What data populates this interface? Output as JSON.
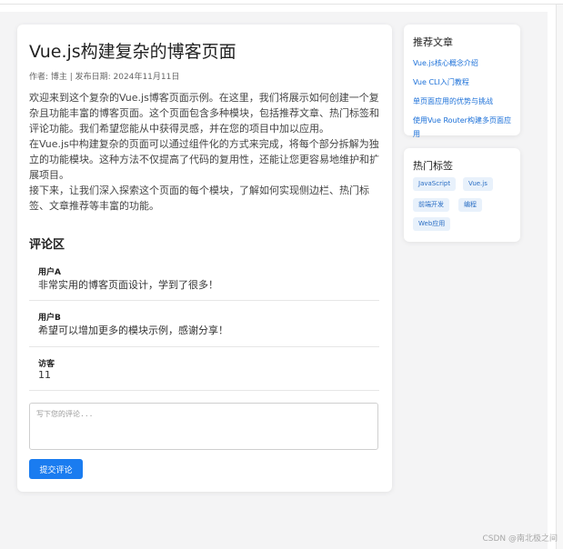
{
  "article": {
    "title": "Vue.js构建复杂的博客页面",
    "meta": "作者: 博主 | 发布日期: 2024年11月11日",
    "paragraphs": [
      "欢迎来到这个复杂的Vue.js博客页面示例。在这里，我们将展示如何创建一个复杂且功能丰富的博客页面。这个页面包含多种模块，包括推荐文章、热门标签和评论功能。我们希望您能从中获得灵感，并在您的项目中加以应用。",
      "在Vue.js中构建复杂的页面可以通过组件化的方式来完成，将每个部分拆解为独立的功能模块。这种方法不仅提高了代码的复用性，还能让您更容易地维护和扩展项目。",
      "接下来，让我们深入探索这个页面的每个模块，了解如何实现侧边栏、热门标签、文章推荐等丰富的功能。"
    ]
  },
  "comments": {
    "title": "评论区",
    "items": [
      {
        "user": "用户A",
        "text": "非常实用的博客页面设计，学到了很多！"
      },
      {
        "user": "用户B",
        "text": "希望可以增加更多的模块示例，感谢分享！"
      },
      {
        "user": "访客",
        "text": "11"
      }
    ],
    "input_value": "",
    "input_placeholder": "写下您的评论...",
    "submit_label": "提交评论"
  },
  "sidebar": {
    "recommended": {
      "title": "推荐文章",
      "links": [
        "Vue.js核心概念介绍",
        "Vue CLI入门教程",
        "单页面应用的优势与挑战",
        "使用Vue Router构建多页面应用"
      ]
    },
    "tags": {
      "title": "热门标签",
      "items": [
        "JavaScript",
        "Vue.js",
        "前端开发",
        "编程",
        "Web应用"
      ]
    }
  },
  "watermark": "CSDN @南北极之间",
  "colors": {
    "accent": "#1a7cf0",
    "link": "#1a6fd8",
    "tag_bg": "#e8f1fb",
    "page_bg": "#f4f4f5"
  }
}
